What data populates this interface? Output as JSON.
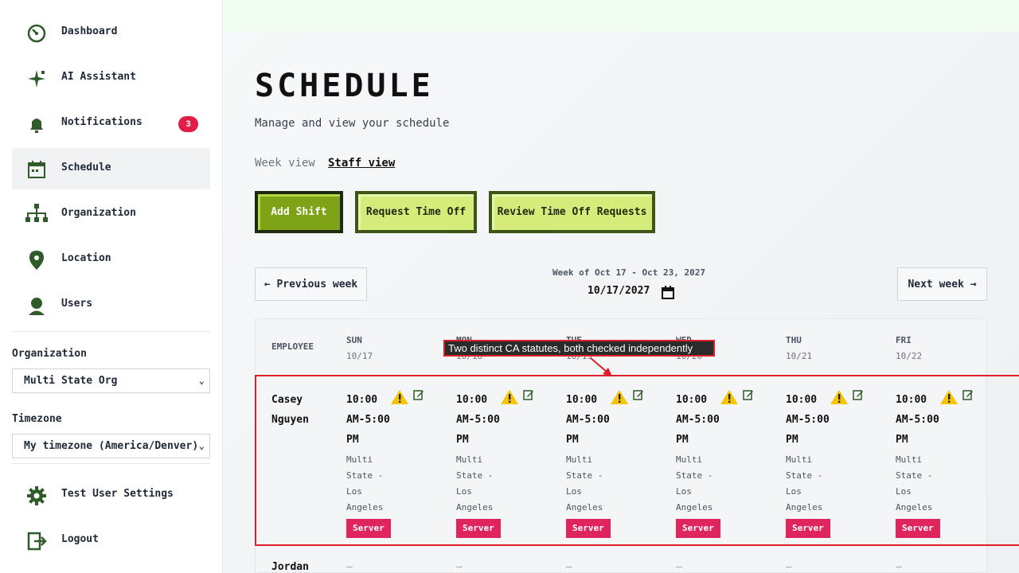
{
  "sidebar": {
    "items": [
      {
        "label": "Dashboard",
        "icon": "dashboard-icon"
      },
      {
        "label": "AI Assistant",
        "icon": "sparkle-icon"
      },
      {
        "label": "Notifications",
        "icon": "bell-icon",
        "badge": "3"
      },
      {
        "label": "Schedule",
        "icon": "calendar-icon",
        "active": true
      },
      {
        "label": "Organization",
        "icon": "org-chart-icon"
      },
      {
        "label": "Location",
        "icon": "map-pin-icon"
      },
      {
        "label": "Users",
        "icon": "user-icon"
      }
    ],
    "organization_label": "Organization",
    "organization_value": "Multi State Org",
    "timezone_label": "Timezone",
    "timezone_value": "My timezone (America/Denver)",
    "settings_label": "Test User Settings",
    "logout_label": "Logout"
  },
  "header": {
    "title": "SCHEDULE",
    "subtitle": "Manage and view your schedule",
    "view_week": "Week view",
    "view_staff": "Staff view"
  },
  "actions": {
    "add_shift": "Add Shift",
    "request_time_off": "Request Time Off",
    "review_requests": "Review Time Off Requests"
  },
  "week": {
    "prev": "← Previous week",
    "next": "Next week →",
    "range": "Week of Oct 17 - Oct 23, 2027",
    "date_value": "10/17/2027"
  },
  "table": {
    "employee_header": "EMPLOYEE",
    "days": [
      {
        "day": "SUN",
        "date": "10/17"
      },
      {
        "day": "MON",
        "date": "10/18"
      },
      {
        "day": "TUE",
        "date": "10/19"
      },
      {
        "day": "WED",
        "date": "10/20"
      },
      {
        "day": "THU",
        "date": "10/21"
      },
      {
        "day": "FRI",
        "date": "10/22"
      }
    ],
    "rows": [
      {
        "first": "Casey",
        "last": "Nguyen",
        "shifts": [
          {
            "t1": "10:00",
            "t2": "AM-5:00",
            "t3": "PM",
            "l1": "Multi",
            "l2": "State -",
            "l3": "Los",
            "l4": "Angeles",
            "role": "Server"
          },
          {
            "t1": "10:00",
            "t2": "AM-5:00",
            "t3": "PM",
            "l1": "Multi",
            "l2": "State -",
            "l3": "Los",
            "l4": "Angeles",
            "role": "Server"
          },
          {
            "t1": "10:00",
            "t2": "AM-5:00",
            "t3": "PM",
            "l1": "Multi",
            "l2": "State -",
            "l3": "Los",
            "l4": "Angeles",
            "role": "Server"
          },
          {
            "t1": "10:00",
            "t2": "AM-5:00",
            "t3": "PM",
            "l1": "Multi",
            "l2": "State -",
            "l3": "Los",
            "l4": "Angeles",
            "role": "Server"
          },
          {
            "t1": "10:00",
            "t2": "AM-5:00",
            "t3": "PM",
            "l1": "Multi",
            "l2": "State -",
            "l3": "Los",
            "l4": "Angeles",
            "role": "Server"
          },
          {
            "t1": "10:00",
            "t2": "AM-5:00",
            "t3": "PM",
            "l1": "Multi",
            "l2": "State -",
            "l3": "Los",
            "l4": "Angeles",
            "role": "Server"
          }
        ]
      },
      {
        "first": "Jordan",
        "empty": "–"
      }
    ]
  },
  "tooltip": "Two distinct CA statutes, both checked independently",
  "colors": {
    "accent": "#7fa316",
    "role_badge": "#e0245e",
    "highlight": "#e11d2a",
    "icon": "#2f5a2a"
  }
}
